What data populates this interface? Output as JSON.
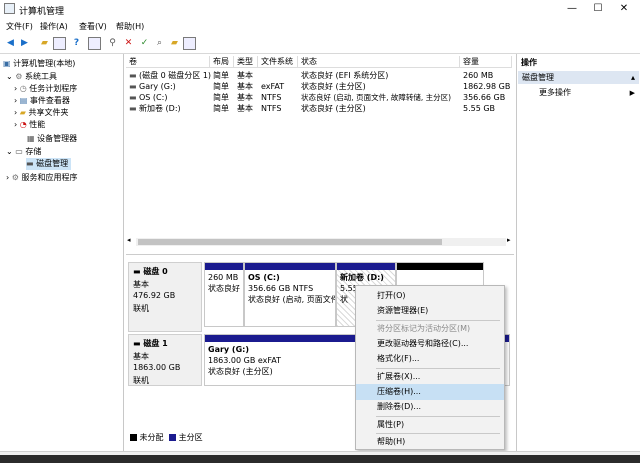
{
  "window": {
    "title": "计算机管理",
    "minimize": "—",
    "maximize": "☐",
    "close": "✕"
  },
  "menu": [
    "文件(F)",
    "操作(A)",
    "查看(V)",
    "帮助(H)"
  ],
  "tree": {
    "root": "计算机管理(本地)",
    "system_tools": "系统工具",
    "task_scheduler": "任务计划程序",
    "event_viewer": "事件查看器",
    "shared_folders": "共享文件夹",
    "performance": "性能",
    "device_manager": "设备管理器",
    "storage": "存储",
    "disk_management": "磁盘管理",
    "services_apps": "服务和应用程序"
  },
  "volume_table": {
    "headers": [
      "卷",
      "布局",
      "类型",
      "文件系统",
      "状态",
      "容量"
    ],
    "rows": [
      {
        "volume": "(磁盘 0 磁盘分区 1)",
        "layout": "简单",
        "type": "基本",
        "fs": "",
        "status": "状态良好 (EFI 系统分区)",
        "capacity": "260 MB"
      },
      {
        "volume": "Gary (G:)",
        "layout": "简单",
        "type": "基本",
        "fs": "exFAT",
        "status": "状态良好 (主分区)",
        "capacity": "1862.98 GB"
      },
      {
        "volume": "OS (C:)",
        "layout": "简单",
        "type": "基本",
        "fs": "NTFS",
        "status": "状态良好 (启动, 页面文件, 故障转储, 主分区)",
        "capacity": "356.66 GB"
      },
      {
        "volume": "新加卷 (D:)",
        "layout": "简单",
        "type": "基本",
        "fs": "NTFS",
        "status": "状态良好 (主分区)",
        "capacity": "5.55 GB"
      }
    ]
  },
  "disks": [
    {
      "name": "磁盘 0",
      "type": "基本",
      "size": "476.92 GB",
      "state": "联机",
      "partitions": [
        {
          "label": "",
          "size": "260 MB",
          "status": "状态良好"
        },
        {
          "label": "OS (C:)",
          "size": "356.66 GB NTFS",
          "status": "状态良好 (启动, 页面文件"
        },
        {
          "label": "新加卷 (D:)",
          "size": "5.55",
          "status": "状"
        },
        {
          "label": "",
          "size": "",
          "status": ""
        }
      ]
    },
    {
      "name": "磁盘 1",
      "type": "基本",
      "size": "1863.00 GB",
      "state": "联机",
      "partitions": [
        {
          "label": "Gary (G:)",
          "size": "1863.00 GB exFAT",
          "status": "状态良好 (主分区)"
        }
      ]
    }
  ],
  "legend": {
    "unallocated": "未分配",
    "primary": "主分区"
  },
  "actions_pane": {
    "header": "操作",
    "section": "磁盘管理",
    "more": "更多操作"
  },
  "context_menu": {
    "items": [
      "打开(O)",
      "资源管理器(E)",
      "将分区标记为活动分区(M)",
      "更改驱动器号和路径(C)...",
      "格式化(F)...",
      "扩展卷(X)...",
      "压缩卷(H)...",
      "删除卷(D)...",
      "属性(P)",
      "帮助(H)"
    ],
    "highlighted_index": 6,
    "disabled_index": 2
  },
  "colors": {
    "primary_partition": "#1b1b8f",
    "unallocated": "#000000",
    "selection": "#cce4f7",
    "menu_highlight": "#c7e0f4"
  }
}
